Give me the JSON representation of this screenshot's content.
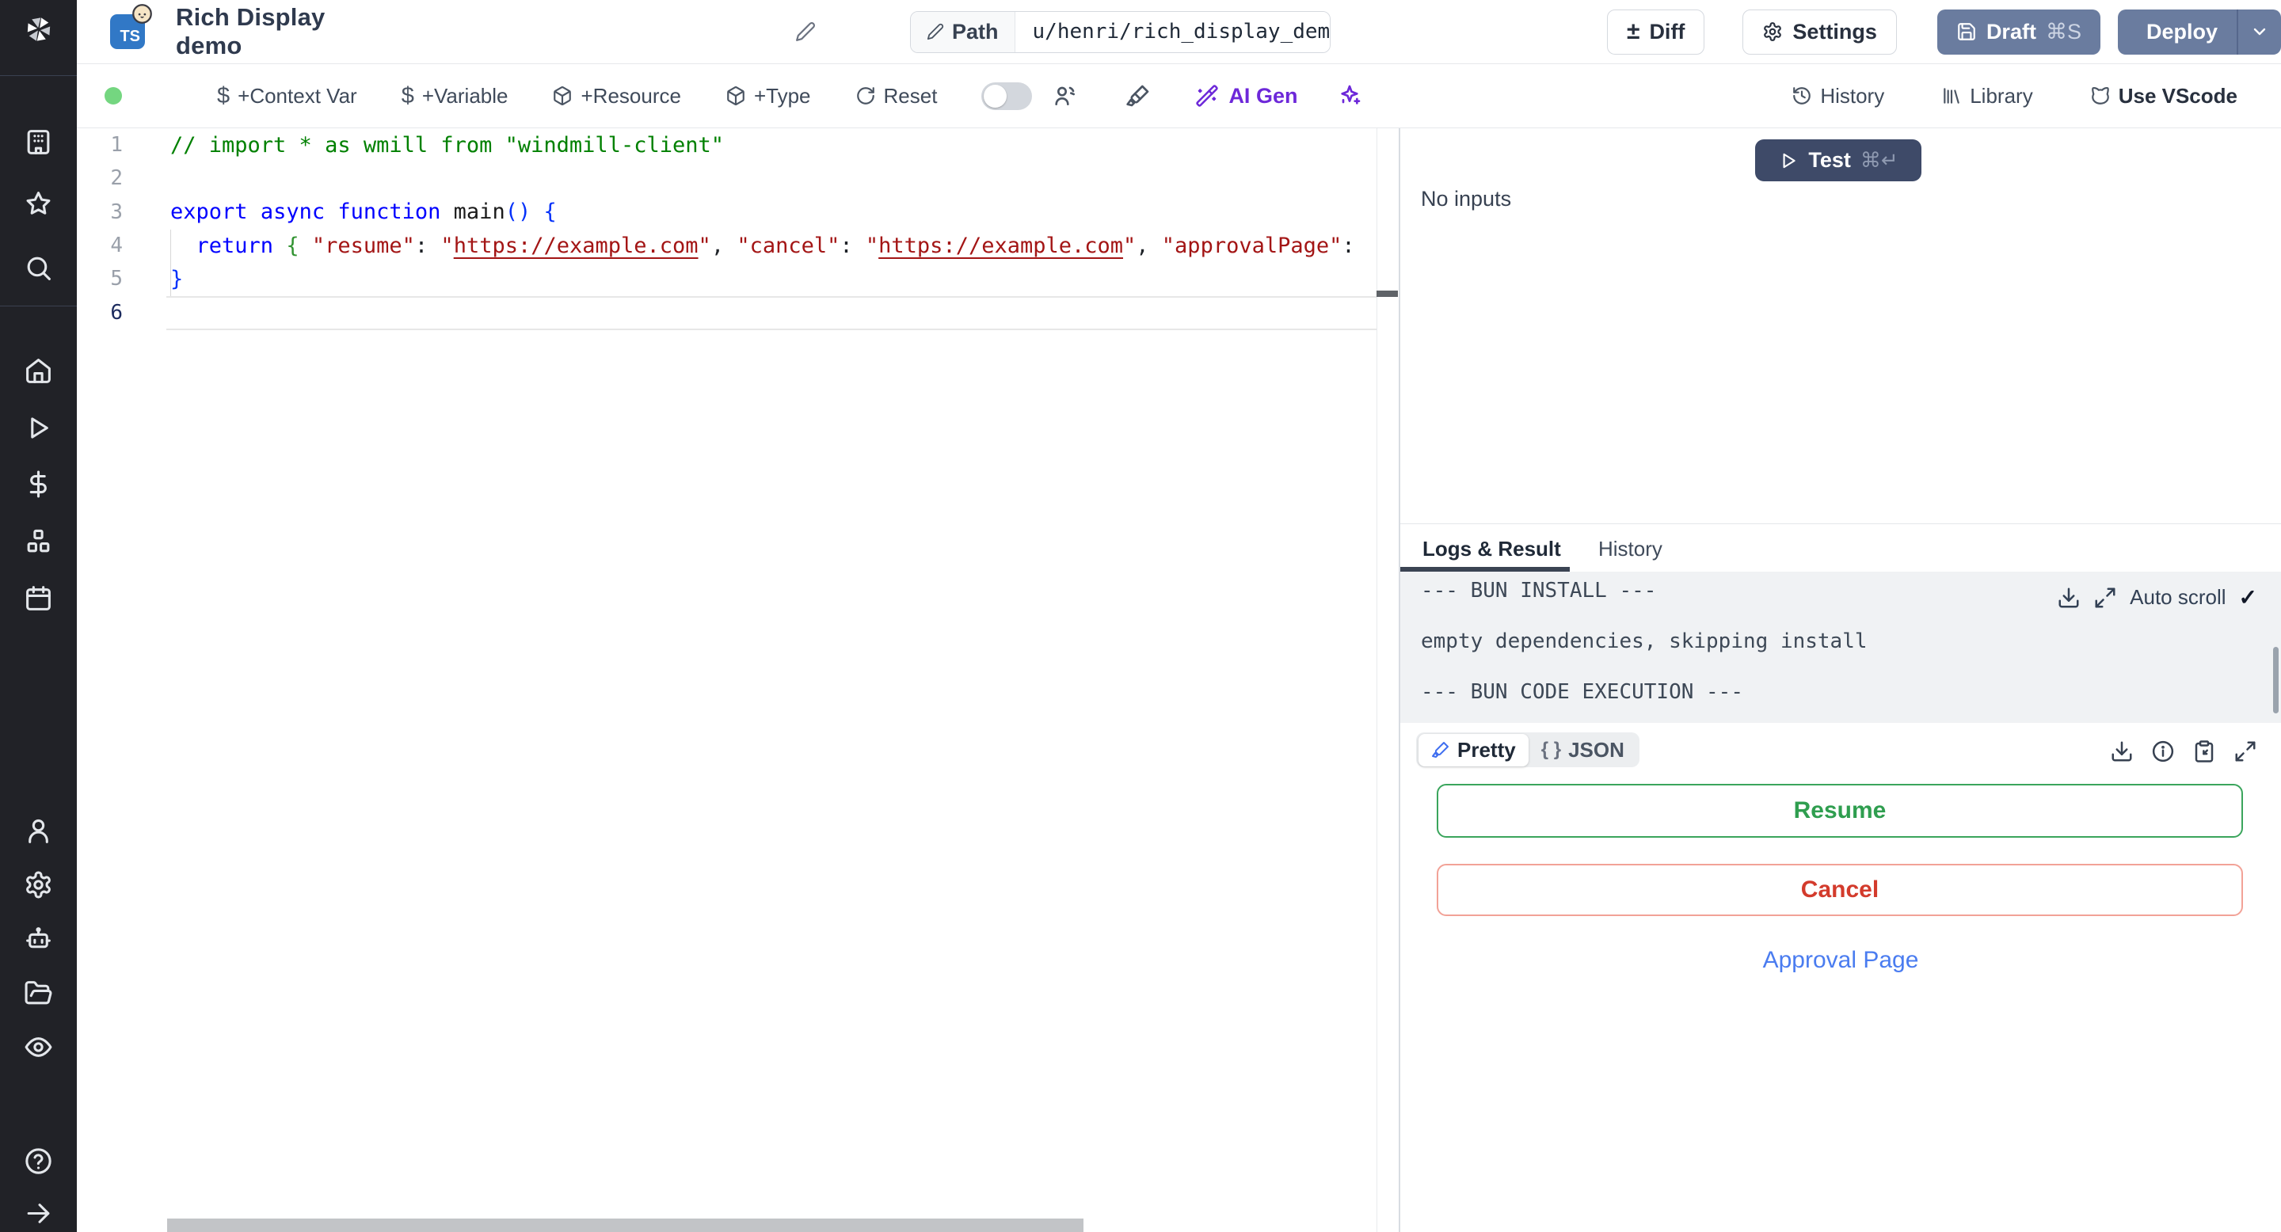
{
  "header": {
    "language_badge": "TS",
    "title": "Rich Display demo",
    "path_label": "Path",
    "path_value": "u/henri/rich_display_demo",
    "diff_label": "Diff",
    "diff_icon_glyph": "±",
    "settings_label": "Settings",
    "draft_label": "Draft",
    "draft_shortcut": "⌘S",
    "deploy_label": "Deploy"
  },
  "toolbar": {
    "add_context_var": "+Context Var",
    "add_variable": "+Variable",
    "add_resource": "+Resource",
    "add_type": "+Type",
    "reset": "Reset",
    "dollar_icon_glyph": "$",
    "ai_gen": "AI Gen",
    "history": "History",
    "library": "Library",
    "use_vscode": "Use VScode"
  },
  "sidebar": {
    "icons": [
      "workspace",
      "favorites",
      "search",
      "home",
      "runs",
      "variables",
      "resources",
      "schedules",
      "users",
      "settings",
      "workers",
      "folders",
      "audit-logs",
      "help",
      "collapse-arrow"
    ]
  },
  "editor": {
    "lines": [
      {
        "num": "1",
        "tokens": [
          {
            "t": "// import * as wmill from \"windmill-client\"",
            "c": "comment"
          }
        ]
      },
      {
        "num": "2",
        "tokens": []
      },
      {
        "num": "3",
        "tokens": [
          {
            "t": "export",
            "c": "kw"
          },
          {
            "t": " ",
            "c": "plain"
          },
          {
            "t": "async",
            "c": "kw"
          },
          {
            "t": " ",
            "c": "plain"
          },
          {
            "t": "function",
            "c": "kw"
          },
          {
            "t": " ",
            "c": "plain"
          },
          {
            "t": "main",
            "c": "ident"
          },
          {
            "t": "()",
            "c": "b1"
          },
          {
            "t": " ",
            "c": "plain"
          },
          {
            "t": "{",
            "c": "b1"
          }
        ]
      },
      {
        "num": "4",
        "tokens": [
          {
            "t": "  ",
            "c": "plain"
          },
          {
            "t": "return",
            "c": "kw"
          },
          {
            "t": " ",
            "c": "plain"
          },
          {
            "t": "{",
            "c": "b2"
          },
          {
            "t": " ",
            "c": "plain"
          },
          {
            "t": "\"resume\"",
            "c": "str"
          },
          {
            "t": ": ",
            "c": "plain"
          },
          {
            "t": "\"",
            "c": "str"
          },
          {
            "t": "https://example.com",
            "c": "link"
          },
          {
            "t": "\"",
            "c": "str"
          },
          {
            "t": ", ",
            "c": "plain"
          },
          {
            "t": "\"cancel\"",
            "c": "str"
          },
          {
            "t": ": ",
            "c": "plain"
          },
          {
            "t": "\"",
            "c": "str"
          },
          {
            "t": "https://example.com",
            "c": "link"
          },
          {
            "t": "\"",
            "c": "str"
          },
          {
            "t": ", ",
            "c": "plain"
          },
          {
            "t": "\"approvalPage\"",
            "c": "str"
          },
          {
            "t": ":",
            "c": "plain"
          }
        ]
      },
      {
        "num": "5",
        "tokens": [
          {
            "t": "}",
            "c": "b1"
          }
        ]
      },
      {
        "num": "6",
        "tokens": []
      }
    ]
  },
  "run_panel": {
    "test_label": "Test",
    "test_shortcut": "⌘↵",
    "no_inputs": "No inputs",
    "tab_logs": "Logs & Result",
    "tab_history": "History",
    "log_lines": [
      "--- BUN INSTALL ---",
      "",
      "empty dependencies, skipping install",
      "",
      "--- BUN CODE EXECUTION ---"
    ],
    "auto_scroll": "Auto scroll",
    "check_glyph": "✓",
    "pretty_label": "Pretty",
    "json_label": "JSON",
    "braces_glyph": "{ }",
    "resume_label": "Resume",
    "cancel_label": "Cancel",
    "approval_label": "Approval Page"
  },
  "colors": {
    "typescript_blue": "#3178c6",
    "header_button_slate": "#6a7c9f",
    "test_button_navy": "#3e4a68",
    "ai_purple": "#6d28d9",
    "status_green": "#74d680",
    "resume_green": "#2f9e4f",
    "cancel_red": "#d33b2c",
    "link_blue": "#4a7cf0",
    "logs_bg": "#f0f2f4",
    "sidebar_bg": "#212227"
  }
}
